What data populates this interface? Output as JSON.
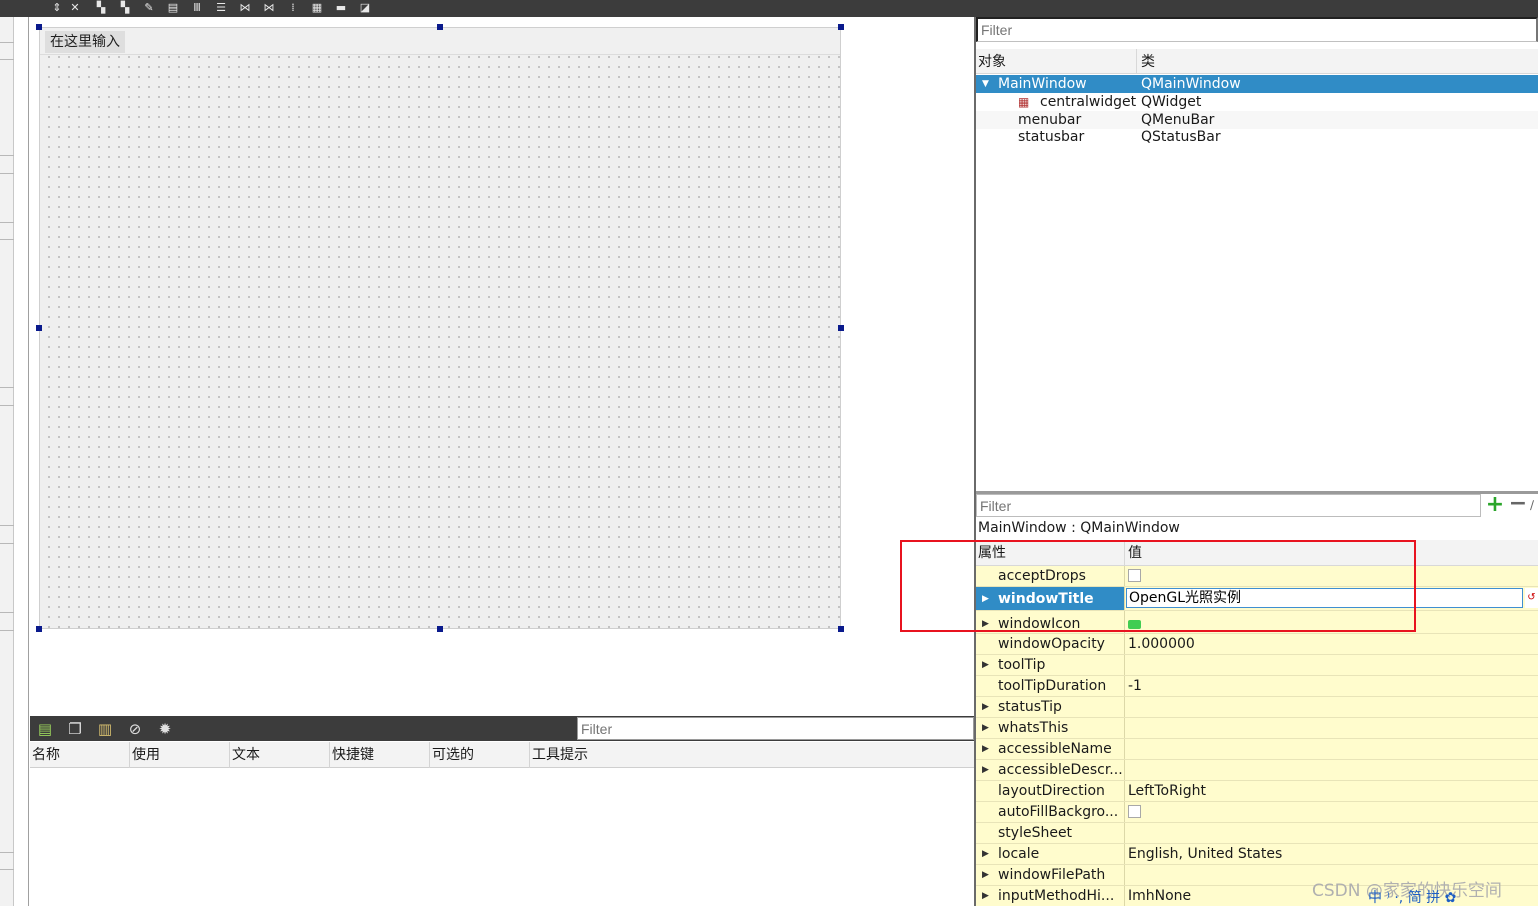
{
  "form": {
    "menu_placeholder": "在这里输入"
  },
  "action_editor": {
    "filter_placeholder": "Filter",
    "toolbar_icons": [
      "new-action-icon",
      "copy-icon",
      "paste-icon",
      "delete-icon",
      "settings-icon"
    ],
    "columns": [
      "名称",
      "使用",
      "文本",
      "快捷键",
      "可选的",
      "工具提示"
    ]
  },
  "object_inspector": {
    "filter_placeholder": "Filter",
    "col_object": "对象",
    "col_class": "类",
    "rows": [
      {
        "name": "MainWindow",
        "class": "QMainWindow"
      },
      {
        "name": "centralwidget",
        "class": "QWidget"
      },
      {
        "name": "menubar",
        "class": "QMenuBar"
      },
      {
        "name": "statusbar",
        "class": "QStatusBar"
      }
    ]
  },
  "property_editor": {
    "filter_placeholder": "Filter",
    "class_label": "MainWindow : QMainWindow",
    "col_property": "属性",
    "col_value": "值",
    "rows": [
      {
        "name": "acceptDrops",
        "value": ""
      },
      {
        "name": "windowTitle",
        "value": "OpenGL光照实例"
      },
      {
        "name": "windowIcon",
        "value": ""
      },
      {
        "name": "windowOpacity",
        "value": "1.000000"
      },
      {
        "name": "toolTip",
        "value": ""
      },
      {
        "name": "toolTipDuration",
        "value": "-1"
      },
      {
        "name": "statusTip",
        "value": ""
      },
      {
        "name": "whatsThis",
        "value": ""
      },
      {
        "name": "accessibleName",
        "value": ""
      },
      {
        "name": "accessibleDescr...",
        "value": ""
      },
      {
        "name": "layoutDirection",
        "value": "LeftToRight"
      },
      {
        "name": "autoFillBackgro...",
        "value": ""
      },
      {
        "name": "styleSheet",
        "value": ""
      },
      {
        "name": "locale",
        "value": "English, United States"
      },
      {
        "name": "windowFilePath",
        "value": ""
      },
      {
        "name": "inputMethodHi...",
        "value": "ImhNone"
      }
    ]
  },
  "watermark": "CSDN @家家的快乐空间",
  "ime_bar": "中 ⁾ ·, 简 拼 ✿",
  "colors": {
    "selection": "#308cc6",
    "property_row": "#fffccd",
    "highlight_box": "#e8131f"
  }
}
